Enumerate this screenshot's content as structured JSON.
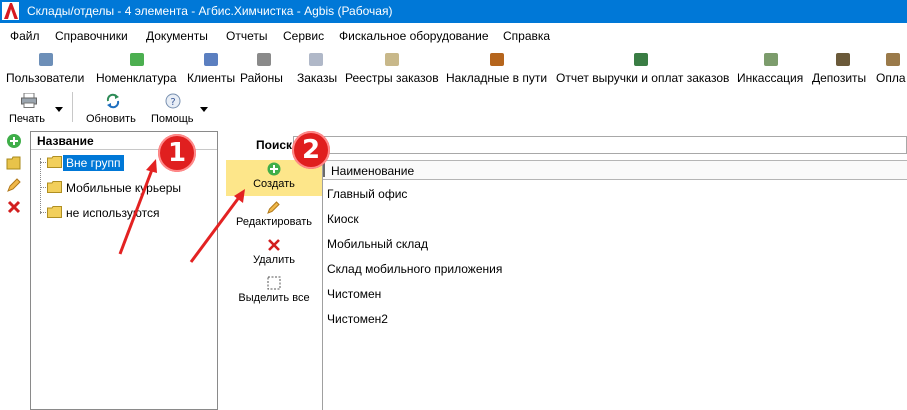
{
  "window": {
    "title": "Склады/отделы - 4 элемента - Агбис.Химчистка - Agbis (Рабочая)",
    "app_icon": "agbis-logo-icon"
  },
  "menu": [
    {
      "label": "Файл"
    },
    {
      "label": "Справочники"
    },
    {
      "label": "Документы"
    },
    {
      "label": "Отчеты"
    },
    {
      "label": "Сервис"
    },
    {
      "label": "Фискальное оборудование"
    },
    {
      "label": "Справка"
    }
  ],
  "ribbon": [
    {
      "label": "Пользователи",
      "icon": "users-icon"
    },
    {
      "label": "Номенклатура",
      "icon": "nomenclature-icon"
    },
    {
      "label": "Клиенты",
      "icon": "client-icon"
    },
    {
      "label": "Районы",
      "icon": "districts-icon"
    },
    {
      "label": "Заказы",
      "icon": "orders-icon"
    },
    {
      "label": "Реестры заказов",
      "icon": "order-registry-icon"
    },
    {
      "label": "Накладные в пути",
      "icon": "truck-icon"
    },
    {
      "label": "Отчет выручки и оплат заказов",
      "icon": "report-icon"
    },
    {
      "label": "Инкассация",
      "icon": "cash-collection-icon"
    },
    {
      "label": "Депозиты",
      "icon": "deposit-icon"
    },
    {
      "label": "Опла",
      "icon": "payment-icon"
    }
  ],
  "toolbar": {
    "print_label": "Печать",
    "refresh_label": "Обновить",
    "help_label": "Помощь"
  },
  "tree": {
    "header": "Название",
    "items": [
      {
        "label": "Вне групп",
        "selected": true
      },
      {
        "label": "Мобильные курьеры",
        "selected": false
      },
      {
        "label": "не используются",
        "selected": false
      }
    ]
  },
  "search": {
    "label": "Поиск",
    "value": "",
    "placeholder": ""
  },
  "actions": {
    "create_label": "Создать",
    "edit_label": "Редактировать",
    "delete_label": "Удалить",
    "select_all_label": "Выделить все"
  },
  "grid": {
    "column_header": "Наименование",
    "rows": [
      {
        "name": "Главный офис"
      },
      {
        "name": "Киоск"
      },
      {
        "name": "Мобильный склад"
      },
      {
        "name": "Склад мобильного приложения"
      },
      {
        "name": "Чистомен"
      },
      {
        "name": "Чистомен2"
      }
    ]
  },
  "annotations": [
    {
      "label": "1"
    },
    {
      "label": "2"
    }
  ],
  "colors": {
    "titlebar": "#0078d7",
    "selection": "#0078d7",
    "active_action": "#fde68a",
    "annotation": "#e01f1f"
  }
}
